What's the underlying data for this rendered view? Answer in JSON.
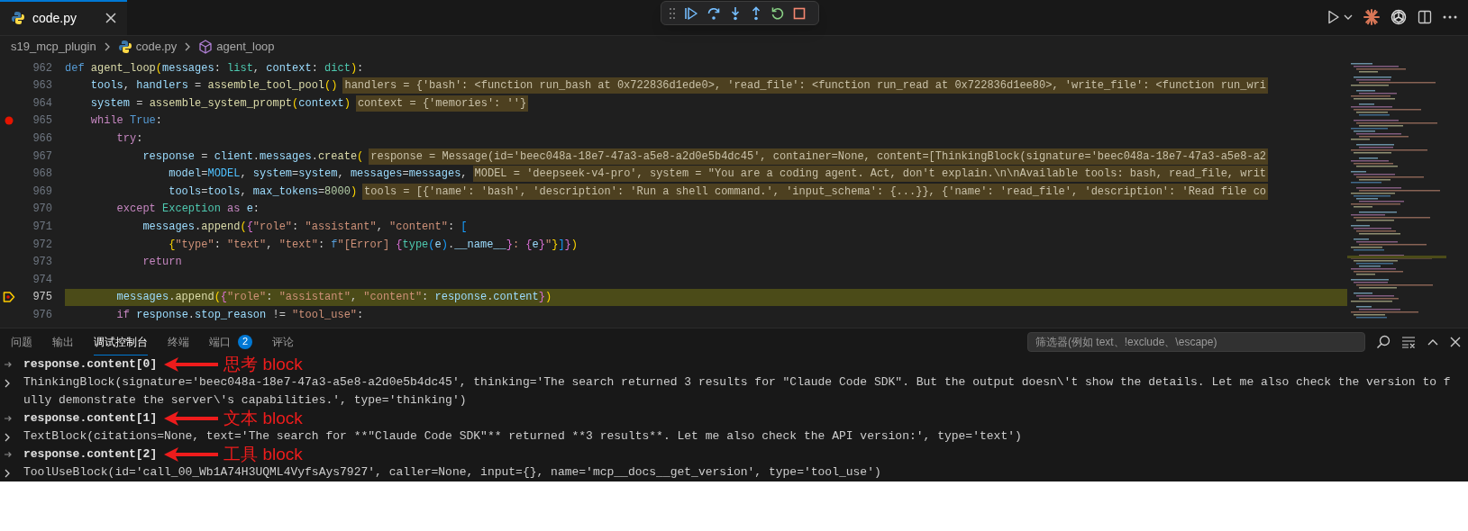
{
  "editor_tabs": [
    {
      "label": "code.py",
      "selected": true
    }
  ],
  "breadcrumb": [
    {
      "label": "s19_mcp_plugin",
      "kind": "folder"
    },
    {
      "label": "code.py",
      "kind": "python"
    },
    {
      "label": "agent_loop",
      "kind": "symbol"
    }
  ],
  "code_lines": [
    {
      "number": "962",
      "breakpoint": false,
      "current": false,
      "tokens": [
        {
          "text": "def ",
          "kind": "def"
        },
        {
          "text": "agent_loop",
          "kind": "fn"
        },
        {
          "text": "(",
          "kind": "b1"
        },
        {
          "text": "messages",
          "kind": "var"
        },
        {
          "text": ": ",
          "kind": "p"
        },
        {
          "text": "list",
          "kind": "cls"
        },
        {
          "text": ", ",
          "kind": "p"
        },
        {
          "text": "context",
          "kind": "var"
        },
        {
          "text": ": ",
          "kind": "p"
        },
        {
          "text": "dict",
          "kind": "cls"
        },
        {
          "text": ")",
          "kind": "b1"
        },
        {
          "text": ":",
          "kind": "p"
        }
      ]
    },
    {
      "number": "963",
      "breakpoint": false,
      "current": false,
      "tokens": [
        {
          "text": "    tools",
          "kind": "var"
        },
        {
          "text": ", ",
          "kind": "p"
        },
        {
          "text": "handlers",
          "kind": "var"
        },
        {
          "text": " = ",
          "kind": "p"
        },
        {
          "text": "assemble_tool_pool",
          "kind": "fn"
        },
        {
          "text": "()",
          "kind": "b1"
        }
      ],
      "hint": "handlers = {'bash': <function run_bash at 0x722836d1ede0>, 'read_file': <function run_read at 0x722836d1ee80>, 'write_file': <function run_wri"
    },
    {
      "number": "964",
      "breakpoint": false,
      "current": false,
      "tokens": [
        {
          "text": "    system",
          "kind": "var"
        },
        {
          "text": " = ",
          "kind": "p"
        },
        {
          "text": "assemble_system_prompt",
          "kind": "fn"
        },
        {
          "text": "(",
          "kind": "b1"
        },
        {
          "text": "context",
          "kind": "var"
        },
        {
          "text": ")",
          "kind": "b1"
        }
      ],
      "hint": "context = {'memories': ''}"
    },
    {
      "number": "965",
      "breakpoint": true,
      "current": false,
      "tokens": [
        {
          "text": "    while ",
          "kind": "kw"
        },
        {
          "text": "True",
          "kind": "def"
        },
        {
          "text": ":",
          "kind": "p"
        }
      ]
    },
    {
      "number": "966",
      "breakpoint": false,
      "current": false,
      "tokens": [
        {
          "text": "        try",
          "kind": "kw"
        },
        {
          "text": ":",
          "kind": "p"
        }
      ]
    },
    {
      "number": "967",
      "breakpoint": false,
      "current": false,
      "tokens": [
        {
          "text": "            response",
          "kind": "var"
        },
        {
          "text": " = ",
          "kind": "p"
        },
        {
          "text": "client",
          "kind": "var"
        },
        {
          "text": ".",
          "kind": "p"
        },
        {
          "text": "messages",
          "kind": "var"
        },
        {
          "text": ".",
          "kind": "p"
        },
        {
          "text": "create",
          "kind": "fn"
        },
        {
          "text": "(",
          "kind": "b1"
        }
      ],
      "hint": "response = Message(id='beec048a-18e7-47a3-a5e8-a2d0e5b4dc45', container=None, content=[ThinkingBlock(signature='beec048a-18e7-47a3-a5e8-a2"
    },
    {
      "number": "968",
      "breakpoint": false,
      "current": false,
      "tokens": [
        {
          "text": "                model",
          "kind": "var"
        },
        {
          "text": "=",
          "kind": "p"
        },
        {
          "text": "MODEL",
          "kind": "const"
        },
        {
          "text": ", ",
          "kind": "p"
        },
        {
          "text": "system",
          "kind": "var"
        },
        {
          "text": "=",
          "kind": "p"
        },
        {
          "text": "system",
          "kind": "var"
        },
        {
          "text": ", ",
          "kind": "p"
        },
        {
          "text": "messages",
          "kind": "var"
        },
        {
          "text": "=",
          "kind": "p"
        },
        {
          "text": "messages",
          "kind": "var"
        },
        {
          "text": ",",
          "kind": "p"
        }
      ],
      "hint": "MODEL = 'deepseek-v4-pro', system = \"You are a coding agent. Act, don't explain.\\n\\nAvailable tools: bash, read_file, writ"
    },
    {
      "number": "969",
      "breakpoint": false,
      "current": false,
      "tokens": [
        {
          "text": "                tools",
          "kind": "var"
        },
        {
          "text": "=",
          "kind": "p"
        },
        {
          "text": "tools",
          "kind": "var"
        },
        {
          "text": ", ",
          "kind": "p"
        },
        {
          "text": "max_tokens",
          "kind": "var"
        },
        {
          "text": "=",
          "kind": "p"
        },
        {
          "text": "8000",
          "kind": "num"
        },
        {
          "text": ")",
          "kind": "b1"
        }
      ],
      "hint": "tools = [{'name': 'bash', 'description': 'Run a shell command.', 'input_schema': {...}}, {'name': 'read_file', 'description': 'Read file co"
    },
    {
      "number": "970",
      "breakpoint": false,
      "current": false,
      "tokens": [
        {
          "text": "        except ",
          "kind": "kw"
        },
        {
          "text": "Exception ",
          "kind": "cls"
        },
        {
          "text": "as ",
          "kind": "kw"
        },
        {
          "text": "e",
          "kind": "var"
        },
        {
          "text": ":",
          "kind": "p"
        }
      ]
    },
    {
      "number": "971",
      "breakpoint": false,
      "current": false,
      "tokens": [
        {
          "text": "            messages",
          "kind": "var"
        },
        {
          "text": ".",
          "kind": "p"
        },
        {
          "text": "append",
          "kind": "fn"
        },
        {
          "text": "(",
          "kind": "b1"
        },
        {
          "text": "{",
          "kind": "b2"
        },
        {
          "text": "\"role\"",
          "kind": "str"
        },
        {
          "text": ": ",
          "kind": "p"
        },
        {
          "text": "\"assistant\"",
          "kind": "str"
        },
        {
          "text": ", ",
          "kind": "p"
        },
        {
          "text": "\"content\"",
          "kind": "str"
        },
        {
          "text": ": ",
          "kind": "p"
        },
        {
          "text": "[",
          "kind": "b3"
        }
      ]
    },
    {
      "number": "972",
      "breakpoint": false,
      "current": false,
      "tokens": [
        {
          "text": "                {",
          "kind": "b1"
        },
        {
          "text": "\"type\"",
          "kind": "str"
        },
        {
          "text": ": ",
          "kind": "p"
        },
        {
          "text": "\"text\"",
          "kind": "str"
        },
        {
          "text": ", ",
          "kind": "p"
        },
        {
          "text": "\"text\"",
          "kind": "str"
        },
        {
          "text": ": ",
          "kind": "p"
        },
        {
          "text": "f",
          "kind": "def"
        },
        {
          "text": "\"[Error] ",
          "kind": "str"
        },
        {
          "text": "{",
          "kind": "b2"
        },
        {
          "text": "type",
          "kind": "cls"
        },
        {
          "text": "(",
          "kind": "b3"
        },
        {
          "text": "e",
          "kind": "var"
        },
        {
          "text": ")",
          "kind": "b3"
        },
        {
          "text": ".",
          "kind": "p"
        },
        {
          "text": "__name__",
          "kind": "var"
        },
        {
          "text": "}",
          "kind": "b2"
        },
        {
          "text": ": ",
          "kind": "str"
        },
        {
          "text": "{",
          "kind": "b2"
        },
        {
          "text": "e",
          "kind": "var"
        },
        {
          "text": "}",
          "kind": "b2"
        },
        {
          "text": "\"",
          "kind": "str"
        },
        {
          "text": "}",
          "kind": "b1"
        },
        {
          "text": "]",
          "kind": "b3"
        },
        {
          "text": "}",
          "kind": "b2"
        },
        {
          "text": ")",
          "kind": "b1"
        }
      ]
    },
    {
      "number": "973",
      "breakpoint": false,
      "current": false,
      "tokens": [
        {
          "text": "            return",
          "kind": "kw"
        }
      ]
    },
    {
      "number": "974",
      "breakpoint": false,
      "current": false
    },
    {
      "number": "975",
      "breakpoint": false,
      "current": true,
      "tokens": [
        {
          "text": "        messages",
          "kind": "var"
        },
        {
          "text": ".",
          "kind": "p"
        },
        {
          "text": "append",
          "kind": "fn"
        },
        {
          "text": "(",
          "kind": "b1"
        },
        {
          "text": "{",
          "kind": "b2"
        },
        {
          "text": "\"role\"",
          "kind": "str"
        },
        {
          "text": ": ",
          "kind": "p"
        },
        {
          "text": "\"assistant\"",
          "kind": "str"
        },
        {
          "text": ", ",
          "kind": "p"
        },
        {
          "text": "\"content\"",
          "kind": "str"
        },
        {
          "text": ": ",
          "kind": "p"
        },
        {
          "text": "response",
          "kind": "var"
        },
        {
          "text": ".",
          "kind": "p"
        },
        {
          "text": "content",
          "kind": "var"
        },
        {
          "text": "}",
          "kind": "b2"
        },
        {
          "text": ")",
          "kind": "b1"
        }
      ]
    },
    {
      "number": "976",
      "breakpoint": false,
      "current": false,
      "tokens": [
        {
          "text": "        if ",
          "kind": "kw"
        },
        {
          "text": "response",
          "kind": "var"
        },
        {
          "text": ".",
          "kind": "p"
        },
        {
          "text": "stop_reason",
          "kind": "var"
        },
        {
          "text": " != ",
          "kind": "p"
        },
        {
          "text": "\"tool_use\"",
          "kind": "str"
        },
        {
          "text": ":",
          "kind": "p"
        }
      ]
    }
  ],
  "panel": {
    "tabs": [
      {
        "label": "问题",
        "selected": false
      },
      {
        "label": "输出",
        "selected": false
      },
      {
        "label": "调试控制台",
        "selected": true
      },
      {
        "label": "终端",
        "selected": false
      },
      {
        "label": "端口",
        "selected": false,
        "badge": "2"
      },
      {
        "label": "评论",
        "selected": false
      }
    ],
    "filter": {
      "placeholder": "筛选器(例如 text、!exclude、\\escape)"
    },
    "console": [
      {
        "kind": "input",
        "text": "response.content[0]",
        "annotation": "思考 block"
      },
      {
        "kind": "output",
        "text": "ThinkingBlock(signature='beec048a-18e7-47a3-a5e8-a2d0e5b4dc45', thinking='The search returned 3 results for \"Claude Code SDK\". But the output doesn\\'t show the details. Let me also check the version to fully demonstrate the server\\'s capabilities.', type='thinking')"
      },
      {
        "kind": "input",
        "text": "response.content[1]",
        "annotation": "文本 block"
      },
      {
        "kind": "output",
        "text": "TextBlock(citations=None, text='The search for **\"Claude Code SDK\"** returned **3 results**. Let me also check the API version:', type='text')"
      },
      {
        "kind": "input",
        "text": "response.content[2]",
        "annotation": "工具 block"
      },
      {
        "kind": "output",
        "text": "ToolUseBlock(id='call_00_Wb1A74H3UQML4VyfsAys7927', caller=None, input={}, name='mcp__docs__get_version', type='tool_use')"
      }
    ]
  }
}
